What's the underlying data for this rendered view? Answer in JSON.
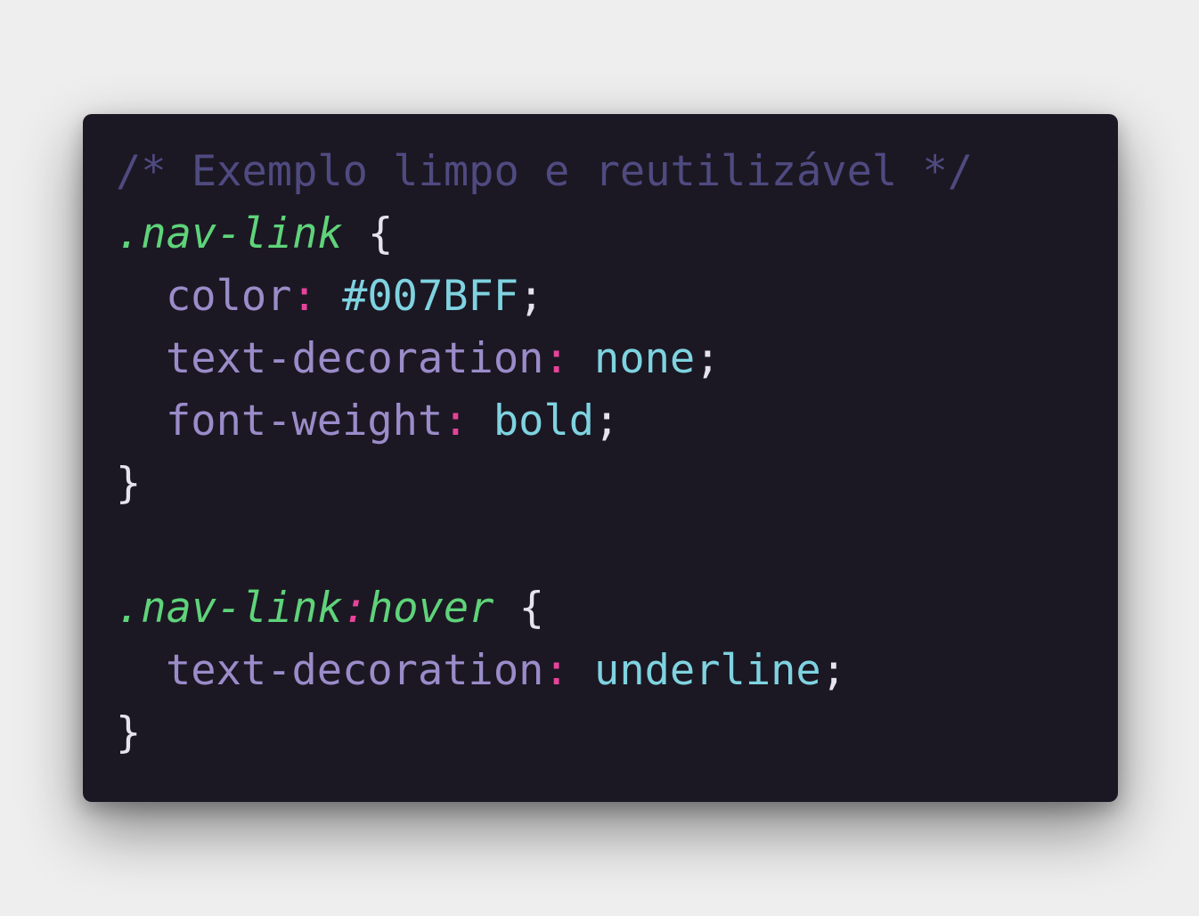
{
  "colors": {
    "card_background": "#1b1823",
    "comment": "#4f4a80",
    "selector": "#5fd37a",
    "property": "#9a8cc9",
    "colon": "#e8439a",
    "value": "#7fd3e0",
    "punctuation": "#e6e2ee"
  },
  "code": {
    "comment": "/* Exemplo limpo e reutilizável */",
    "rule1": {
      "selector": ".nav-link",
      "open_brace": "{",
      "decl1": {
        "property": "color",
        "colon": ":",
        "value": "#007BFF",
        "semicolon": ";"
      },
      "decl2": {
        "property": "text-decoration",
        "colon": ":",
        "value": "none",
        "semicolon": ";"
      },
      "decl3": {
        "property": "font-weight",
        "colon": ":",
        "value": "bold",
        "semicolon": ";"
      },
      "close_brace": "}"
    },
    "rule2": {
      "selector": ".nav-link",
      "pseudo_colon": ":",
      "pseudo": "hover",
      "open_brace": "{",
      "decl1": {
        "property": "text-decoration",
        "colon": ":",
        "value": "underline",
        "semicolon": ";"
      },
      "close_brace": "}"
    }
  }
}
